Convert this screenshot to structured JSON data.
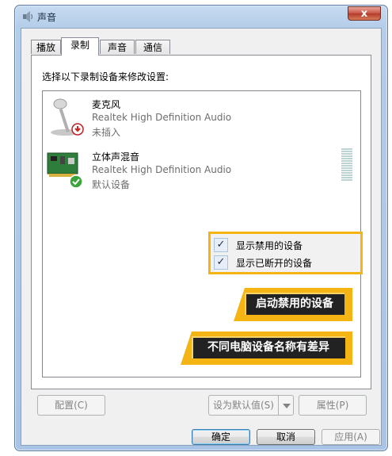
{
  "window": {
    "title": "声音",
    "close_label": "x"
  },
  "tabs": [
    {
      "label": "播放",
      "active": false
    },
    {
      "label": "录制",
      "active": true
    },
    {
      "label": "声音",
      "active": false
    },
    {
      "label": "通信",
      "active": false
    }
  ],
  "panel": {
    "prompt": "选择以下录制设备来修改设置:"
  },
  "devices": [
    {
      "name": "麦克风",
      "driver": "Realtek High Definition Audio",
      "status": "未插入",
      "icon": "microphone-icon",
      "badge": "unplugged-badge-icon"
    },
    {
      "name": "立体声混音",
      "driver": "Realtek High Definition Audio",
      "status": "默认设备",
      "icon": "sound-card-icon",
      "badge": "default-check-icon"
    }
  ],
  "context_menu": {
    "items": [
      {
        "label": "显示禁用的设备",
        "checked": true
      },
      {
        "label": "显示已断开的设备",
        "checked": true
      }
    ],
    "check_glyph": "✓"
  },
  "annotations": {
    "enable_disabled": "启动禁用的设备",
    "device_names_vary": "不同电脑设备名称有差异"
  },
  "buttons": {
    "configure": "配置(C)",
    "set_default": "设为默认值(S)",
    "properties": "属性(P)",
    "ok": "确定",
    "cancel": "取消",
    "apply": "应用(A)"
  },
  "colors": {
    "annotation_yellow": "#f4b514",
    "annotation_dark": "#222222",
    "accent_blue": "#3c7fb1"
  }
}
